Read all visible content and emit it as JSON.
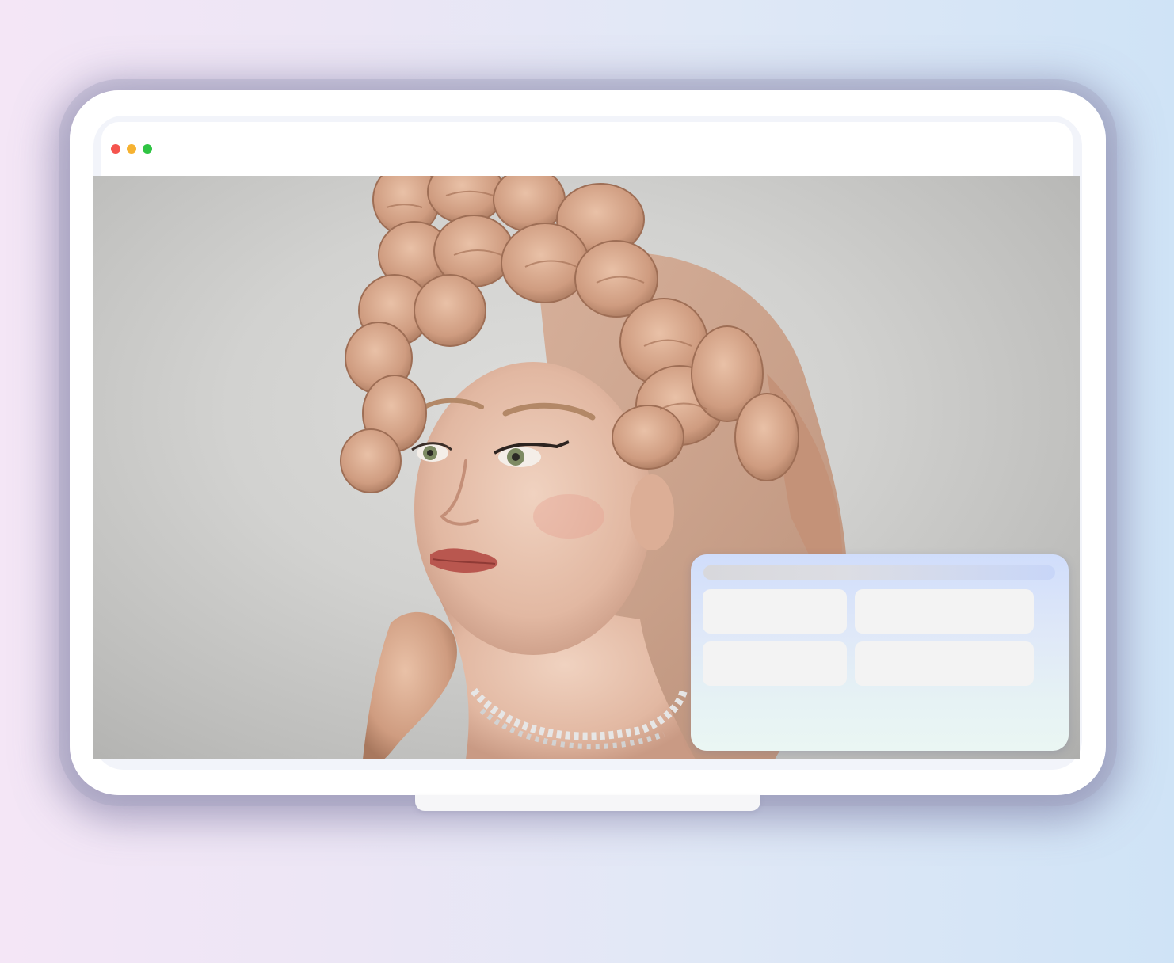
{
  "window": {
    "controls": [
      "close",
      "minimize",
      "maximize"
    ],
    "colors": {
      "close": "#f5544e",
      "minimize": "#f6b231",
      "maximize": "#2fc443"
    }
  },
  "hero_image": {
    "subject": "portrait-with-sculpted-hands-headpiece"
  },
  "overlay_panel": {
    "tiles": 4
  }
}
